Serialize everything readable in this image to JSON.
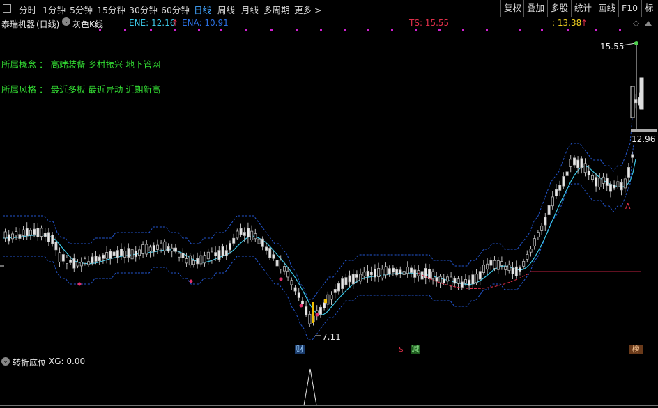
{
  "toolbar": {
    "periods": [
      "分时",
      "1分钟",
      "5分钟",
      "15分钟",
      "30分钟",
      "60分钟",
      "日线",
      "周线",
      "月线",
      "多周期",
      "更多 >"
    ],
    "selected": "日线",
    "right_buttons": [
      "复权",
      "叠加",
      "多股",
      "统计",
      "画线",
      "F10",
      "标记"
    ]
  },
  "header": {
    "stock_name": "泰瑞机器",
    "period_tag": "(日线)",
    "kline_mode": "灰色K线",
    "ene": "ENE: 12.16",
    "ene_arrow": "↑",
    "ena": "ENA: 10.91",
    "ts": "TS: 15.55",
    "right_val": ": 13.38",
    "right_arrow": "↑",
    "diamond": "◇"
  },
  "concepts": {
    "line1": "所属概念 ： 高端装备 乡村振兴 地下管网",
    "line2": "所属风格 ： 最近多板 最近异动 近期新高"
  },
  "chart_labels": {
    "high": "15.55",
    "low": "7.11",
    "current": "12.96",
    "marker_cai": "财",
    "marker_s": "$",
    "marker_jian": "减",
    "marker_bang": "榜",
    "marker_a": "A"
  },
  "indicator": {
    "name": "转折底位",
    "value": "XG: 0.00"
  },
  "colors": {
    "up_candle": "#b8b8b8",
    "down_candle": "#e8e8e8",
    "ma_line": "#3cc8e8",
    "band_line": "#2255cc",
    "ts_color": "#e0304a",
    "concept": "#33dd33",
    "toolbar_selected": "#42a5ff",
    "dots": "#d020d0"
  }
}
